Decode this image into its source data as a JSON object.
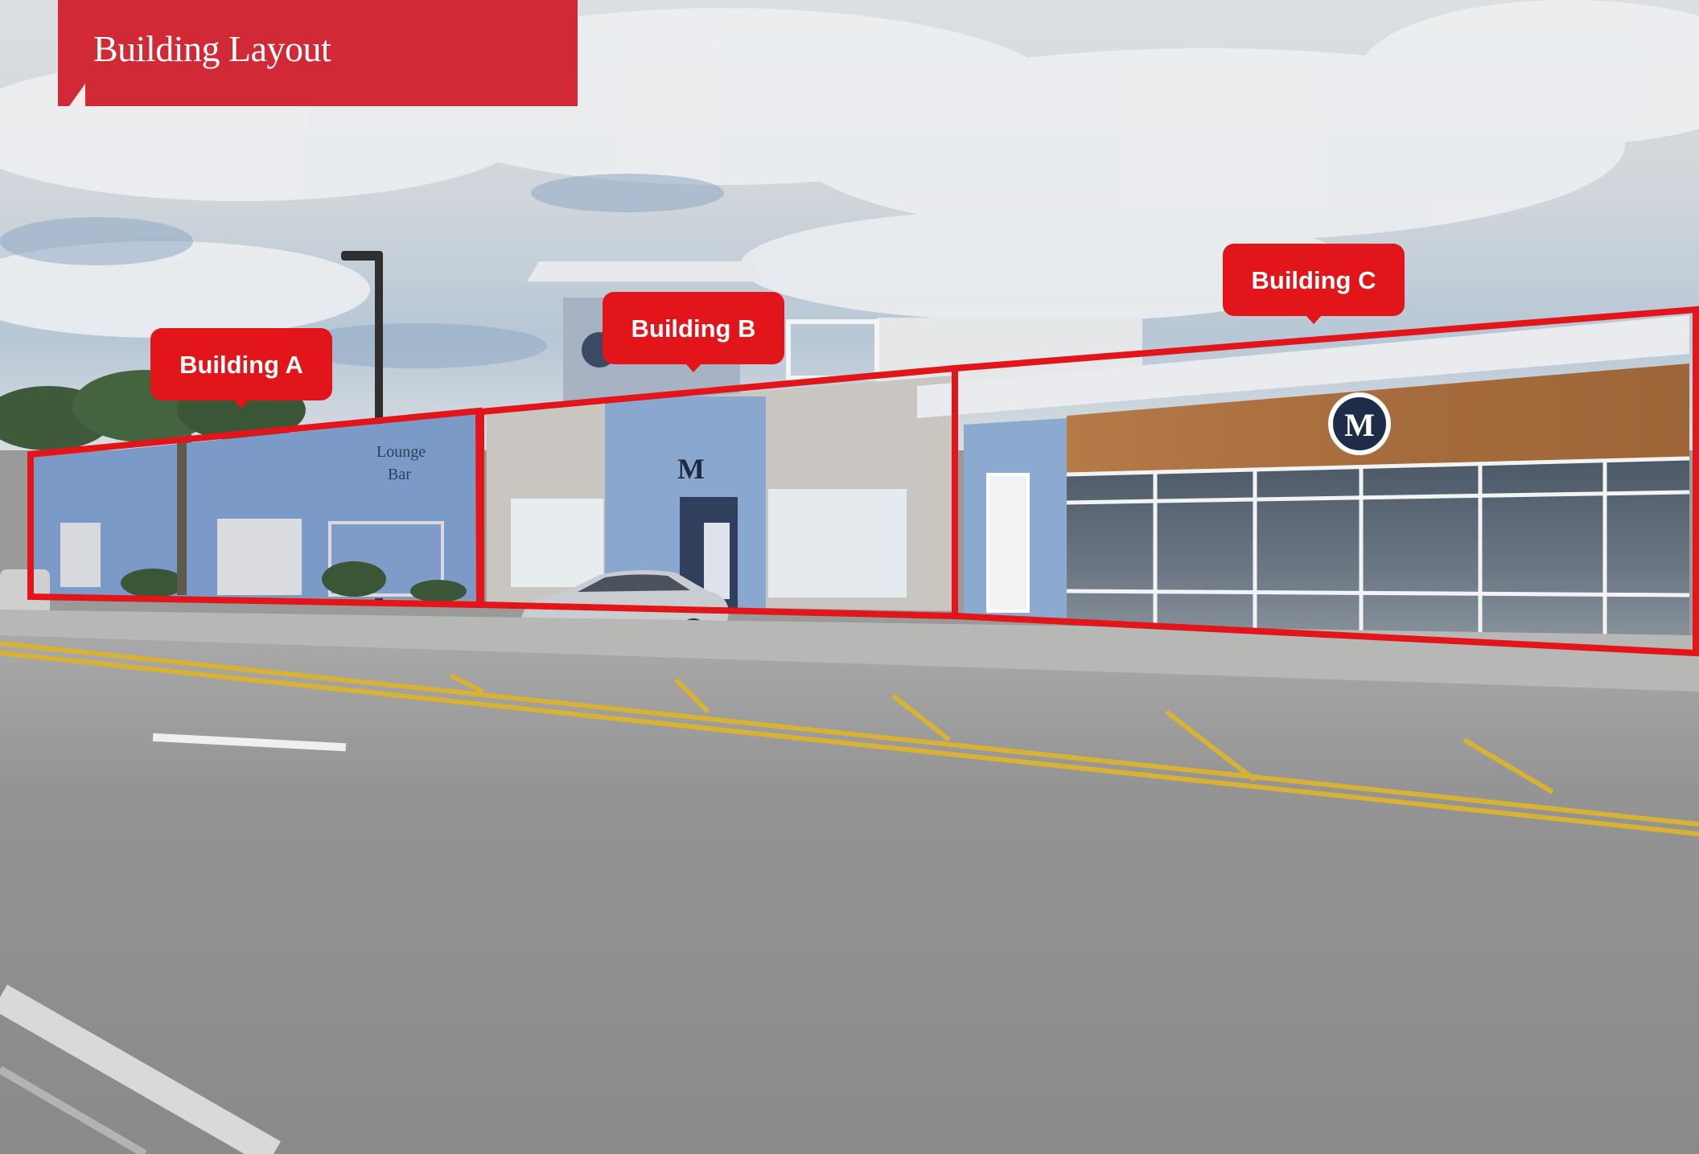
{
  "title": "Building Layout",
  "callouts": [
    {
      "label": "Building A"
    },
    {
      "label": "Building B"
    },
    {
      "label": "Building C"
    }
  ],
  "signage": {
    "building_b_logo": "M",
    "building_c_logo": "M",
    "lounge_line1": "Lounge",
    "lounge_line2": "Bar"
  },
  "colors": {
    "accent_red": "#d12a36",
    "outline_red": "#e1151a",
    "sky": "#c9d3dc",
    "asphalt": "#8d8d8d",
    "road_yellow": "#d8b232"
  }
}
